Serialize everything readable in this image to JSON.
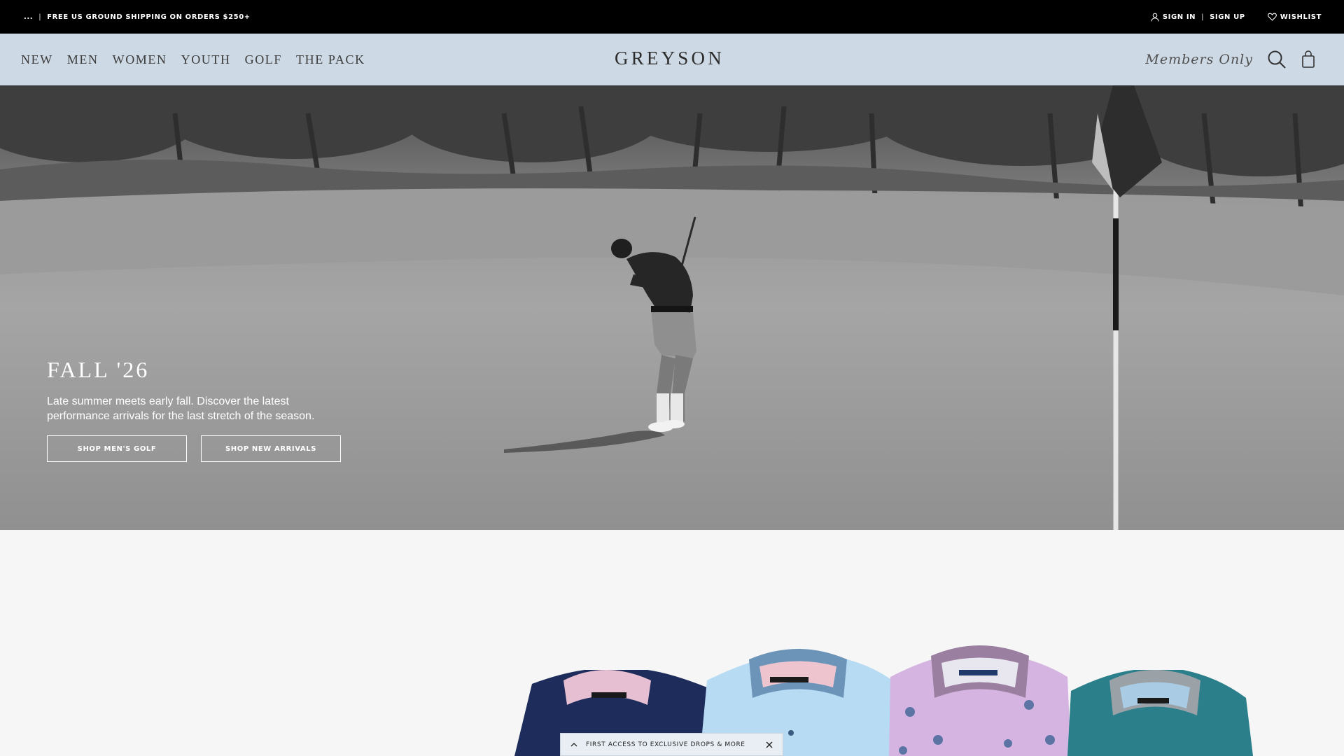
{
  "announcement": {
    "dots": "...",
    "divider": "|",
    "message": "FREE US GROUND SHIPPING ON ORDERS $250+",
    "sign_in": "SIGN IN",
    "sign_up": "SIGN UP",
    "wishlist": "WISHLIST"
  },
  "nav": {
    "links": [
      "NEW",
      "MEN",
      "WOMEN",
      "YOUTH",
      "GOLF",
      "THE PACK"
    ],
    "logo": "GREYSON",
    "members": "Members Only"
  },
  "hero": {
    "title": "FALL '26",
    "subtitle": "Late summer meets early fall. Discover the latest performance arrivals for the last stretch of the season.",
    "buttons": [
      "SHOP MEN'S GOLF",
      "SHOP NEW ARRIVALS"
    ]
  },
  "signup_bar": {
    "text": "FIRST ACCESS TO EXCLUSIVE DROPS & MORE"
  },
  "icons": {
    "user": "user-icon",
    "heart": "heart-icon",
    "search": "search-icon",
    "bag": "shopping-bag-icon",
    "chevron": "chevron-up-icon",
    "close": "close-icon"
  },
  "colors": {
    "topbar": "#000000",
    "nav_bg": "#cdd9e4",
    "page_bg": "#f6f6f6"
  }
}
